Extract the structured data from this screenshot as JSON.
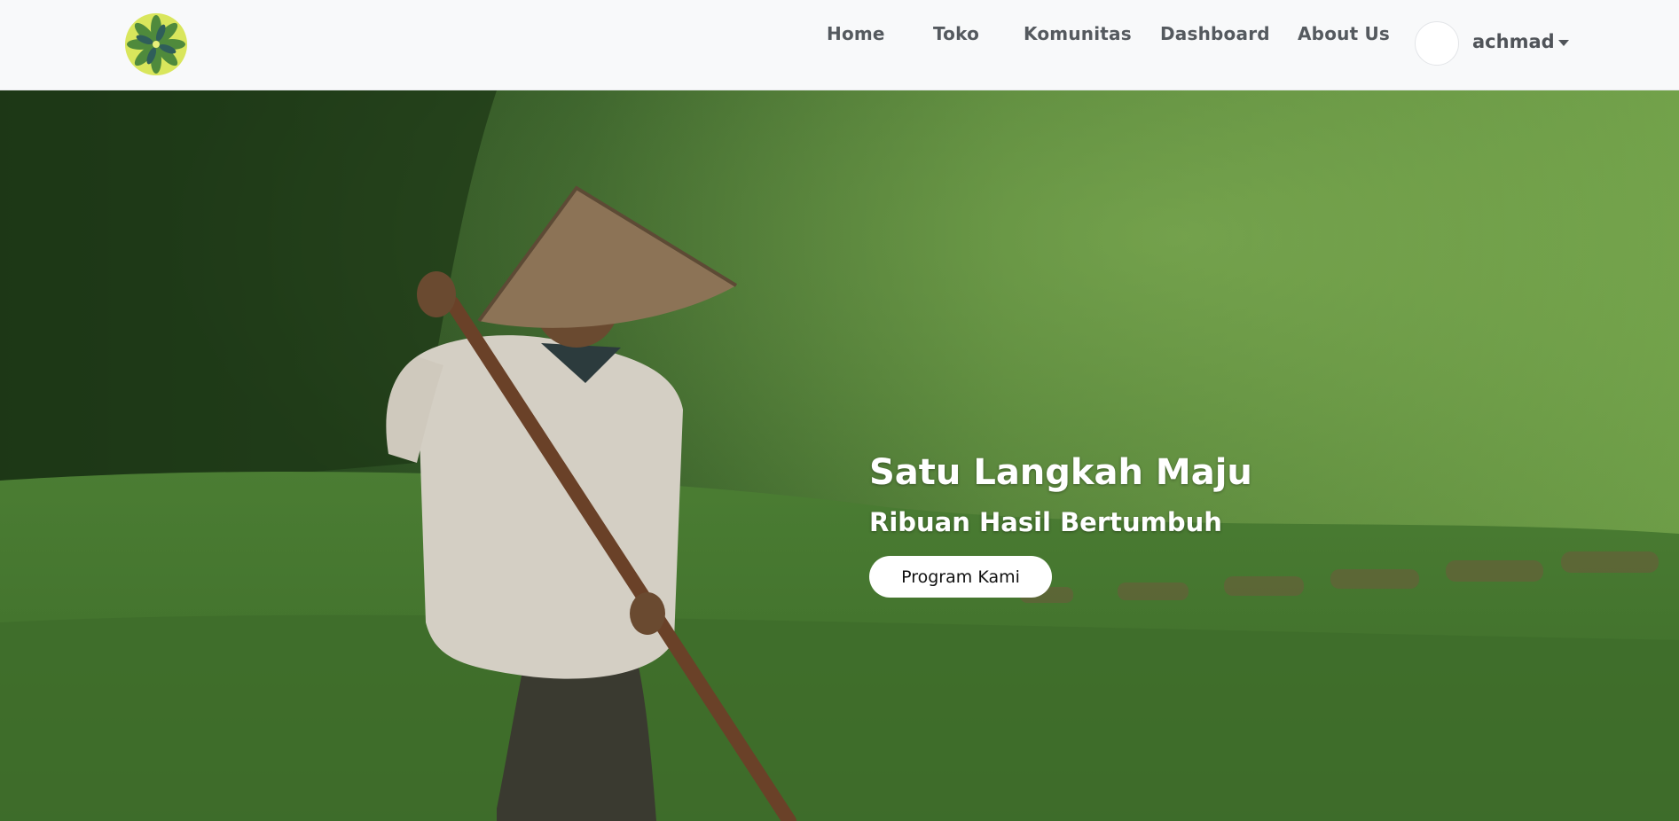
{
  "navbar": {
    "logo_icon": "flower-logo-icon",
    "links": [
      {
        "label": "Home"
      },
      {
        "label": "Toko"
      },
      {
        "label": "Komunitas"
      },
      {
        "label": "Dashboard"
      },
      {
        "label": "About Us"
      }
    ],
    "user": {
      "name": "achmad",
      "menu_icon": "caret-down-icon"
    }
  },
  "hero": {
    "title": "Satu Langkah Maju",
    "subtitle": "Ribuan Hasil Bertumbuh",
    "button_label": "Program Kami",
    "image": "farmer-in-field-photo"
  },
  "colors": {
    "navbar_bg": "#f8f9fa",
    "nav_text": "#555a5f",
    "hero_text": "#ffffff",
    "button_bg": "#ffffff"
  }
}
